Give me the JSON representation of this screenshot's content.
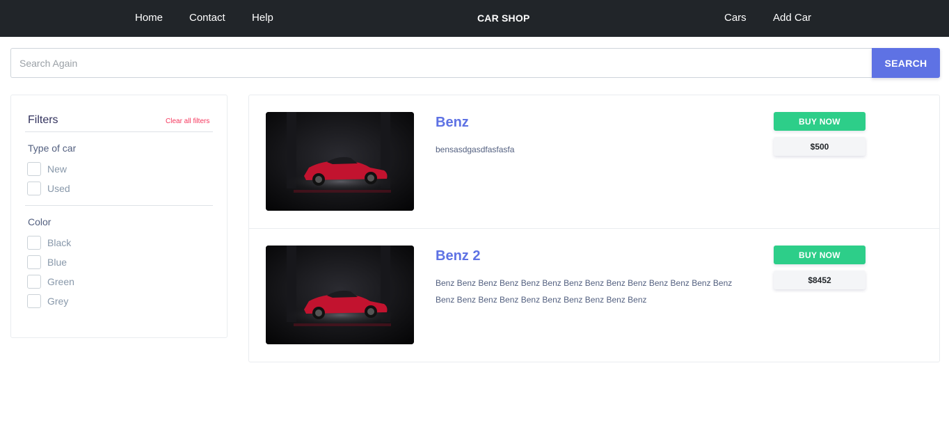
{
  "navbar": {
    "links_left": [
      "Home",
      "Contact",
      "Help"
    ],
    "brand": "CAR SHOP",
    "links_right": [
      "Cars",
      "Add Car"
    ]
  },
  "search": {
    "placeholder": "Search Again",
    "value": "",
    "button_label": "SEARCH"
  },
  "filters": {
    "title": "Filters",
    "clear_label": "Clear all filters",
    "groups": [
      {
        "title": "Type of car",
        "options": [
          "New",
          "Used"
        ]
      },
      {
        "title": "Color",
        "options": [
          "Black",
          "Blue",
          "Green",
          "Grey"
        ]
      }
    ]
  },
  "cars": [
    {
      "name": "Benz",
      "description": "bensasdgasdfasfasfa",
      "buy_label": "BUY NOW",
      "price": "$500"
    },
    {
      "name": "Benz 2",
      "description": "Benz Benz Benz Benz Benz Benz Benz Benz Benz Benz Benz Benz Benz Benz Benz Benz Benz Benz Benz Benz Benz Benz Benz Benz",
      "buy_label": "BUY NOW",
      "price": "$8452"
    }
  ],
  "colors": {
    "navbar_bg": "#212529",
    "primary": "#5e72e4",
    "success": "#2dce89",
    "danger": "#f5365c"
  },
  "icons": [
    "checkbox-icon",
    "car-photo"
  ]
}
